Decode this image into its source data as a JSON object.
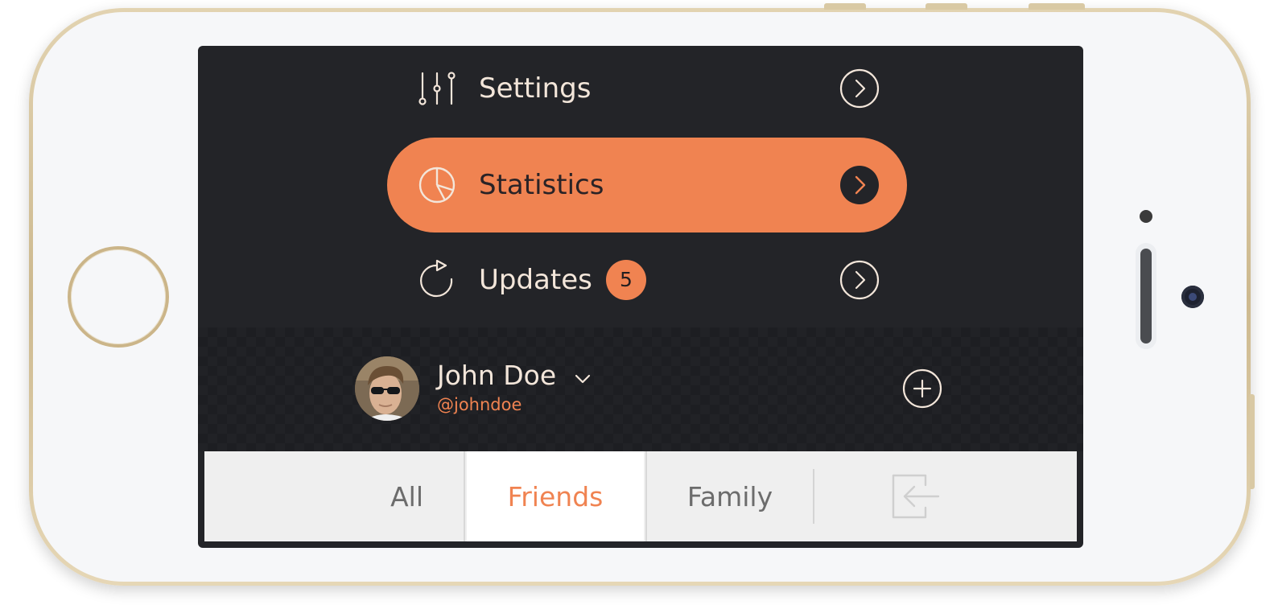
{
  "menu": {
    "items": [
      {
        "label": "Settings",
        "icon": "sliders-icon",
        "active": false
      },
      {
        "label": "Statistics",
        "icon": "pie-chart-icon",
        "active": true
      },
      {
        "label": "Updates",
        "icon": "refresh-icon",
        "active": false,
        "badge": "5"
      }
    ]
  },
  "profile": {
    "name": "John Doe",
    "handle": "@johndoe"
  },
  "tabs": {
    "items": [
      {
        "label": "All",
        "active": false
      },
      {
        "label": "Friends",
        "active": true
      },
      {
        "label": "Family",
        "active": false
      }
    ]
  },
  "colors": {
    "accent": "#f08351",
    "background": "#232428",
    "text_light": "#f3e6da",
    "tab_bar": "#efefef"
  }
}
